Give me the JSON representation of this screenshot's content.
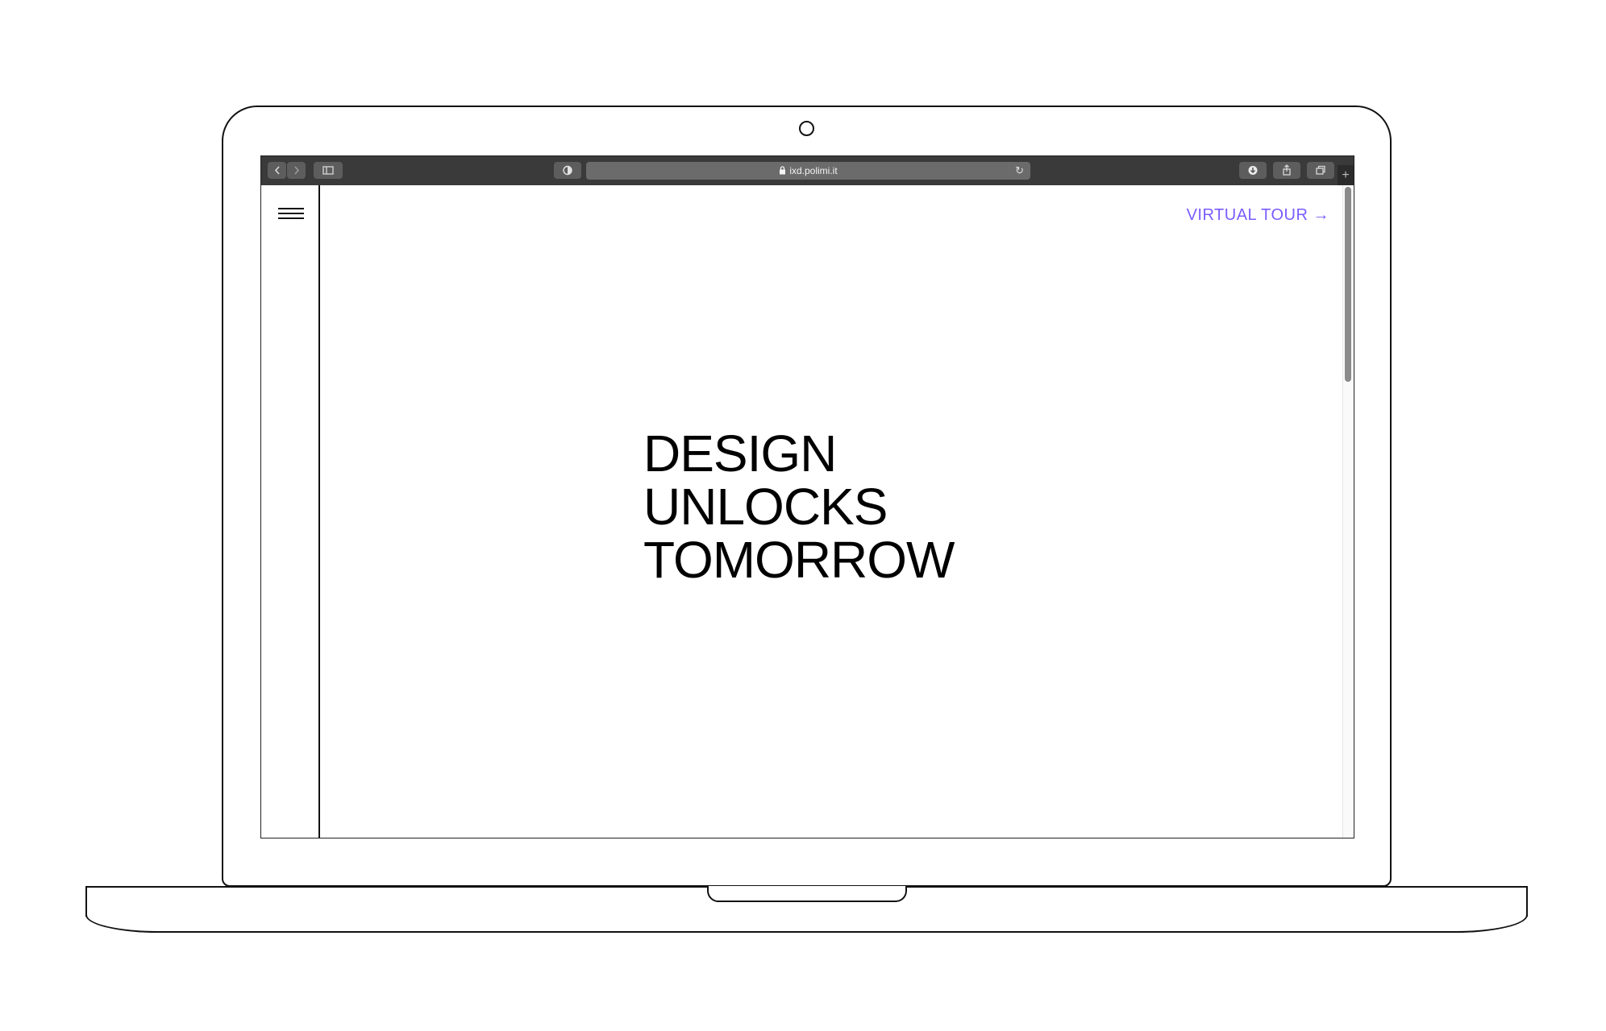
{
  "browser": {
    "url": "ixd.polimi.it",
    "buttons": {
      "back_icon": "chevron-left-icon",
      "forward_icon": "chevron-right-icon",
      "sidebar_icon": "sidebar-icon",
      "privacy_icon": "shield-icon",
      "reload_icon": "reload-icon",
      "download_icon": "download-icon",
      "share_icon": "share-icon",
      "tabs_icon": "tabs-icon",
      "new_tab_icon": "plus-icon",
      "new_tab_glyph": "+"
    }
  },
  "page": {
    "nav": {
      "menu_icon": "hamburger-menu-icon"
    },
    "virtual_tour": {
      "label": "VIRTUAL TOUR →",
      "color": "#7a5cff"
    },
    "headline": {
      "line1": "DESIGN",
      "line2": "UNLOCKS",
      "line3": "TOMORROW"
    }
  }
}
